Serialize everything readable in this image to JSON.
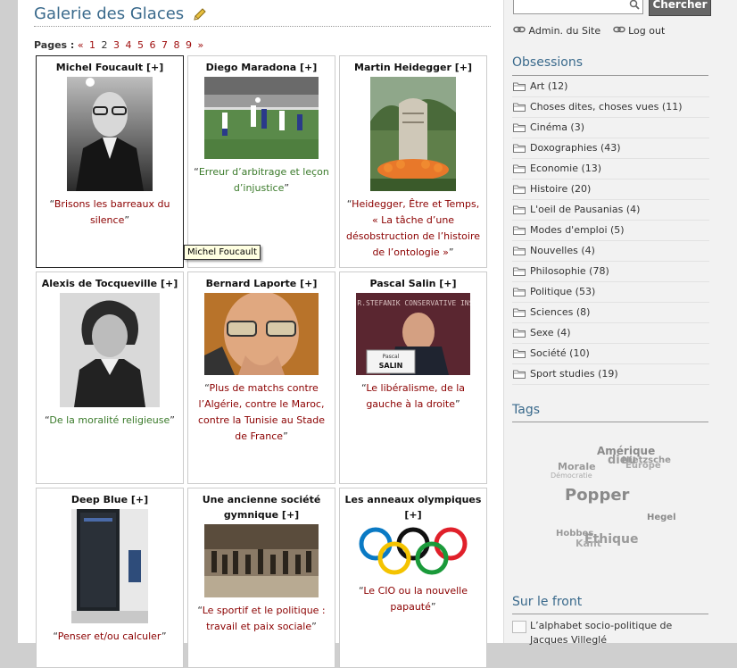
{
  "main": {
    "title": "Galerie des Glaces",
    "pagination": {
      "label": "Pages :",
      "prev": "«",
      "pages": [
        "1",
        "2",
        "3",
        "4",
        "5",
        "6",
        "7",
        "8",
        "9"
      ],
      "current": "2",
      "next": "»"
    },
    "tooltip": "Michel Foucault",
    "cards": [
      {
        "name": "Michel Foucault [+]",
        "caption": "Brisons les barreaux du silence",
        "caption_color": "red"
      },
      {
        "name": "Diego Maradona [+]",
        "caption": "Erreur d’arbitrage et leçon d’injustice",
        "caption_color": "green"
      },
      {
        "name": "Martin Heidegger [+]",
        "caption": "Heidegger, Être et Temps, « La tâche d’une désobstruction de l’histoire de l’ontologie »",
        "caption_color": "red"
      },
      {
        "name": "Alexis de Tocqueville [+]",
        "caption": "De la moralité religieuse",
        "caption_color": "green"
      },
      {
        "name": "Bernard Laporte [+]",
        "caption": "Plus de matchs contre l’Algérie, contre le Maroc, contre la Tunisie au Stade de France",
        "caption_color": "red"
      },
      {
        "name": "Pascal Salin [+]",
        "caption": "Le libéralisme, de la gauche à la droite",
        "caption_color": "red"
      },
      {
        "name": "Deep Blue [+]",
        "caption": "Penser et/ou calculer",
        "caption_color": "red"
      },
      {
        "name": "Une ancienne société gymnique [+]",
        "caption": "Le sportif et le politique : travail et paix sociale",
        "caption_color": "red"
      },
      {
        "name": "Les anneaux olympiques [+]",
        "caption": "Le CIO ou la nouvelle papauté",
        "caption_color": "red"
      }
    ],
    "thumb_texts": {
      "salin_banner": "M.R.STEFANIK CONSERVATIVE INST",
      "salin_nameplate_1": "Pascal",
      "salin_nameplate_2": "SALIN"
    }
  },
  "sidebar": {
    "search": {
      "placeholder": "",
      "button": "Chercher"
    },
    "admin_links": [
      "Admin. du Site",
      "Log out"
    ],
    "obsessions_title": "Obsessions",
    "categories": [
      "Art (12)",
      "Choses dites, choses vues (11)",
      "Cinéma (3)",
      "Doxographies (43)",
      "Economie (13)",
      "Histoire (20)",
      "L'oeil de Pausanias (4)",
      "Modes d'emploi (5)",
      "Nouvelles (4)",
      "Philosophie (78)",
      "Politique (53)",
      "Sciences (8)",
      "Sexe (4)",
      "Société (10)",
      "Sport studies (19)"
    ],
    "tags_title": "Tags",
    "tags": [
      {
        "text": "Amérique",
        "size": 12
      },
      {
        "text": "dieu",
        "size": 13
      },
      {
        "text": "Nietzsche",
        "size": 10
      },
      {
        "text": "Europe",
        "size": 10
      },
      {
        "text": "Morale",
        "size": 11
      },
      {
        "text": "Démocratie",
        "size": 8
      },
      {
        "text": "Popper",
        "size": 18
      },
      {
        "text": "Hegel",
        "size": 10
      },
      {
        "text": "Hobbes",
        "size": 10
      },
      {
        "text": "Ethique",
        "size": 14
      },
      {
        "text": "Kant",
        "size": 11
      }
    ],
    "front_title": "Sur le front",
    "front_items": [
      "L’alphabet socio-politique de Jacques Villeglé"
    ]
  },
  "colors": {
    "accent": "#3a6a8c",
    "link_red": "#8b0000",
    "link_green": "#3a7a2a"
  }
}
